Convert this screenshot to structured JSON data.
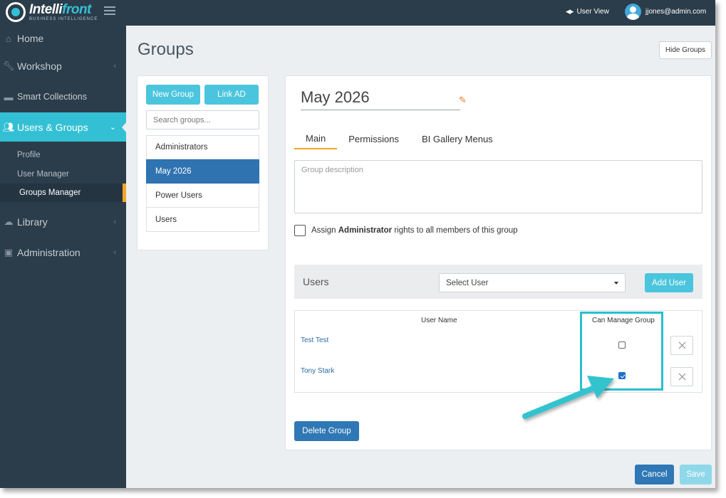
{
  "header": {
    "logo_main": "Intelli",
    "logo_front": "front",
    "logo_sub": "BUSINESS INTELLIGENCE",
    "user_view_label": "User View",
    "account_email": "jjones@admin.com"
  },
  "sidebar": {
    "items": [
      {
        "label": "Home",
        "icon": "home-icon"
      },
      {
        "label": "Workshop",
        "icon": "wrench-icon"
      },
      {
        "label": "Smart Collections",
        "icon": "folder-icon"
      },
      {
        "label": "Users & Groups",
        "icon": "users-icon"
      },
      {
        "label": "Library",
        "icon": "cloud-icon"
      },
      {
        "label": "Administration",
        "icon": "briefcase-icon"
      }
    ],
    "sub_items": [
      {
        "label": "Profile"
      },
      {
        "label": "User Manager"
      },
      {
        "label": "Groups Manager"
      }
    ]
  },
  "page": {
    "title": "Groups",
    "hide_groups_label": "Hide Groups"
  },
  "groups_panel": {
    "new_group_label": "New Group",
    "link_ad_label": "Link AD",
    "search_placeholder": "Search groups...",
    "groups": [
      "Administrators",
      "May 2026",
      "Power Users",
      "Users"
    ],
    "selected": "May 2026"
  },
  "group_detail": {
    "name": "May 2026",
    "tabs": [
      "Main",
      "Permissions",
      "BI Gallery Menus"
    ],
    "active_tab": "Main",
    "description_placeholder": "Group description",
    "assign_prefix": "Assign",
    "assign_bold": "Administrator",
    "assign_suffix": "rights to all members of this group",
    "assign_checked": false,
    "users_title": "Users",
    "select_user_label": "Select User",
    "add_user_label": "Add User",
    "table": {
      "col_user": "User Name",
      "col_manage": "Can Manage Group",
      "rows": [
        {
          "name": "Test Test",
          "can_manage": false
        },
        {
          "name": "Tony Stark",
          "can_manage": true
        }
      ]
    },
    "delete_label": "Delete Group"
  },
  "footer": {
    "cancel_label": "Cancel",
    "save_label": "Save"
  },
  "colors": {
    "accent": "#34c0d4",
    "sidebar_bg": "#2b3c4a",
    "primary_button": "#2f78b5",
    "highlight": "#2bbfce",
    "active_marker": "#f5a623"
  }
}
